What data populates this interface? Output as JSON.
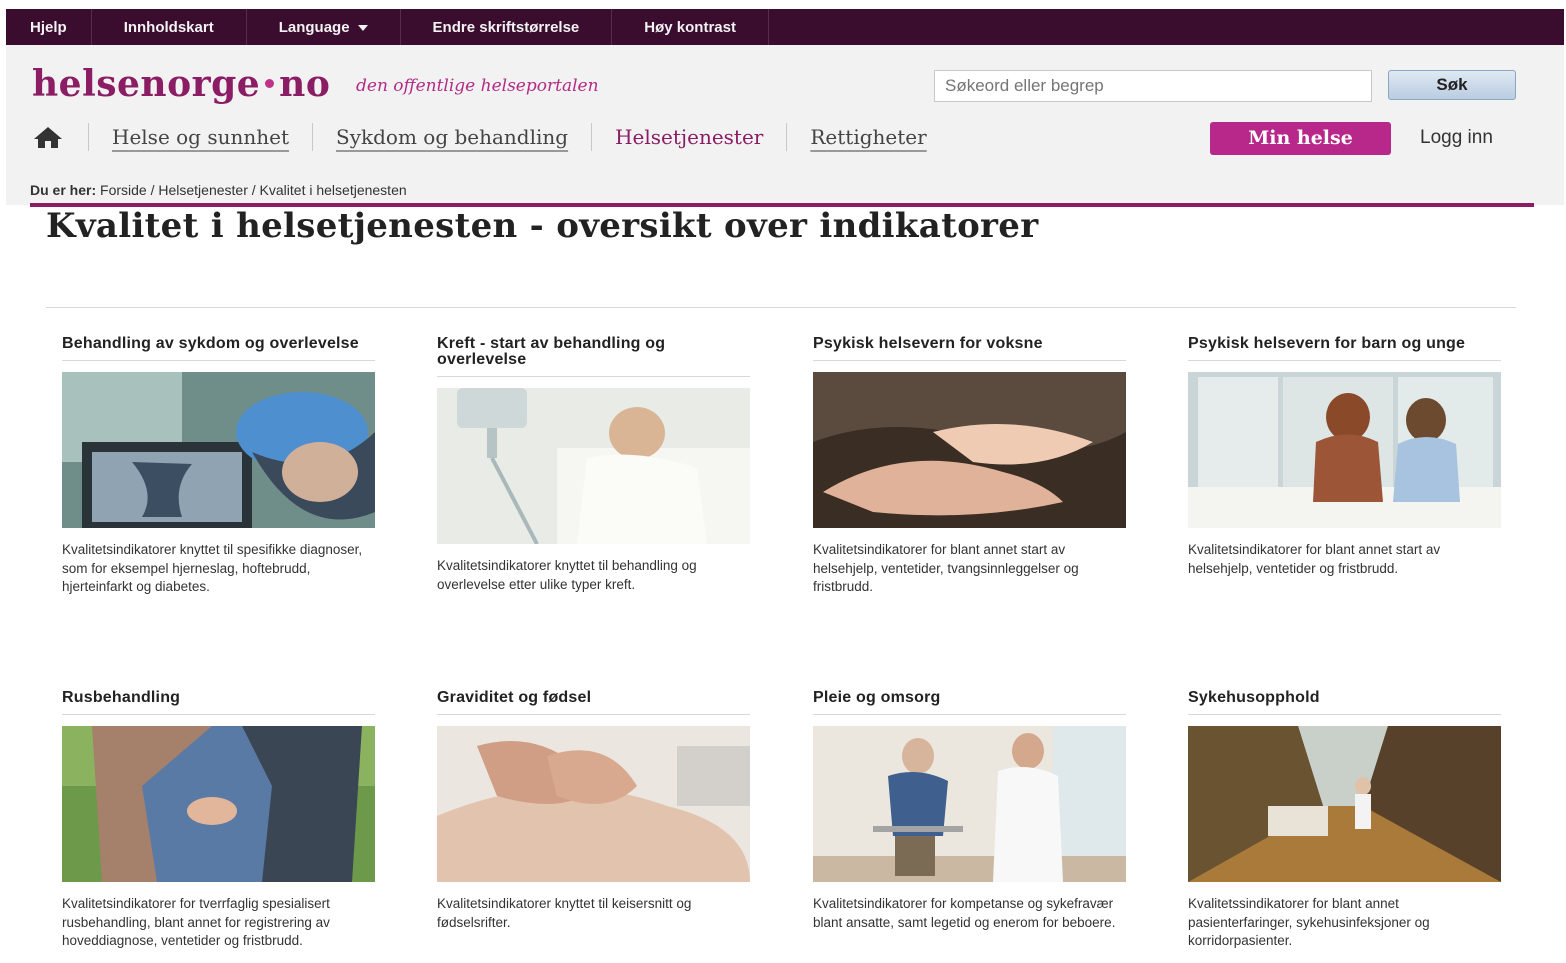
{
  "topbar": {
    "items": [
      "Hjelp",
      "Innholdskart",
      "Language",
      "Endre skriftstørrelse",
      "Høy kontrast"
    ]
  },
  "logo": {
    "left": "helsenorge",
    "right": "no",
    "tagline": "den offentlige helseportalen"
  },
  "search": {
    "placeholder": "Søkeord eller begrep",
    "button": "Søk"
  },
  "nav": {
    "items": [
      "Helse og sunnhet",
      "Sykdom og behandling",
      "Helsetjenester",
      "Rettigheter"
    ],
    "active": "Helsetjenester"
  },
  "account": {
    "min_helse": "Min helse",
    "login": "Logg inn"
  },
  "breadcrumb": {
    "label": "Du er her:",
    "items": [
      "Forside",
      "Helsetjenester",
      "Kvalitet i helsetjenesten"
    ]
  },
  "page_title": "Kvalitet i helsetjenesten - oversikt over indikatorer",
  "cards": [
    {
      "title": "Behandling av sykdom og overlevelse",
      "image": "surgeon-monitor-image",
      "desc": "Kvalitetsindikatorer knyttet til spesifikke diagnoser, som for eksempel hjerneslag, hoftebrudd, hjerteinfarkt og diabetes."
    },
    {
      "title": "Kreft - start av behandling og overlevelse",
      "image": "iv-drip-patient-image",
      "desc": "Kvalitetsindikatorer knyttet til behandling og overlevelse etter ulike typer kreft."
    },
    {
      "title": "Psykisk helsevern for voksne",
      "image": "holding-hands-image",
      "desc": "Kvalitetsindikatorer for blant annet start av helsehjelp, ventetider, tvangsinnleggelser og fristbrudd."
    },
    {
      "title": "Psykisk helsevern for barn og unge",
      "image": "children-window-image",
      "desc": "Kvalitetsindikatorer for blant annet start av helsehjelp, ventetider og fristbrudd."
    },
    {
      "title": "Rusbehandling",
      "image": "couple-holding-hands-image",
      "desc": "Kvalitetsindikatorer for tverrfaglig spesialisert rusbehandling, blant annet for registrering av hoveddiagnose, ventetider og fristbrudd."
    },
    {
      "title": "Graviditet og fødsel",
      "image": "pregnant-belly-image",
      "desc": "Kvalitetsindikatorer knyttet til keisersnitt og fødselsrifter."
    },
    {
      "title": "Pleie og omsorg",
      "image": "elderly-walker-nurse-image",
      "desc": "Kvalitetsindikatorer for kompetanse og sykefravær blant ansatte, samt legetid og enerom for beboere."
    },
    {
      "title": "Sykehusopphold",
      "image": "hospital-corridor-image",
      "desc": "Kvalitetssindikatorer for blant annet pasienterfaringer, sykehusinfeksjoner og korridorpasienter."
    }
  ],
  "colors": {
    "brand": "#8a1d63",
    "topbar": "#3a0c2e",
    "accent_button": "#b8288a"
  }
}
